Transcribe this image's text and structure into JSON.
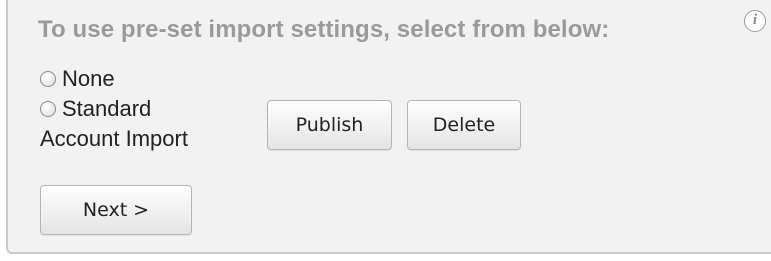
{
  "form": {
    "heading": "To use pre-set import settings, select from below:",
    "info_icon_glyph": "i",
    "options": [
      {
        "label": "None",
        "selected": false
      },
      {
        "label_line1": "Standard",
        "label_line2": "Account Import",
        "selected": false
      }
    ],
    "publish_label": "Publish",
    "delete_label": "Delete",
    "next_label": "Next >"
  }
}
